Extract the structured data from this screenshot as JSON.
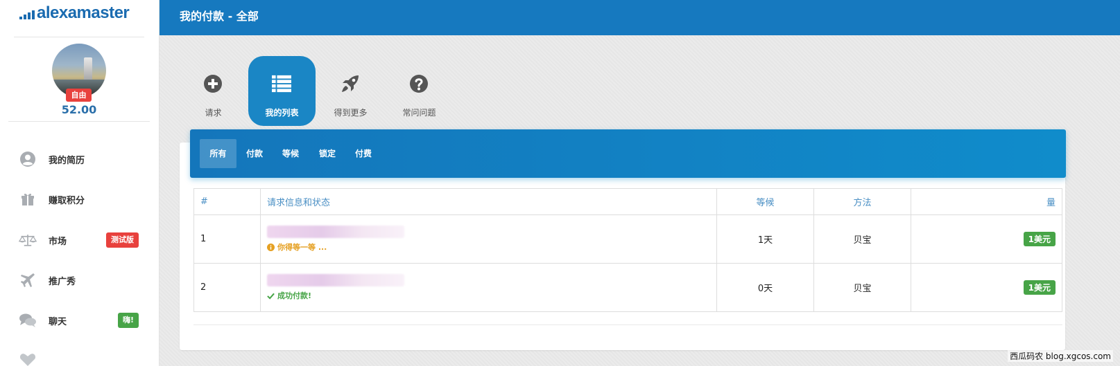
{
  "brand": {
    "name": "alexamaster",
    "color": "#1a6bb0"
  },
  "profile": {
    "badge": "自由",
    "points": "52.00"
  },
  "sidebar": {
    "items": [
      {
        "label": "我的简历",
        "icon": "user-circle-icon",
        "badge": ""
      },
      {
        "label": "赚取积分",
        "icon": "gift-icon",
        "badge": ""
      },
      {
        "label": "市场",
        "icon": "scale-icon",
        "badge": "测试版",
        "badge_color": "#e8413d"
      },
      {
        "label": "推广秀",
        "icon": "plane-icon",
        "badge": ""
      },
      {
        "label": "聊天",
        "icon": "chat-icon",
        "badge": "嗨!",
        "badge_color": "#47a447"
      }
    ]
  },
  "header": {
    "title": "我的付款 - 全部",
    "color": "#1679bf"
  },
  "actions": [
    {
      "label": "请求",
      "icon": "plus-circle-icon"
    },
    {
      "label": "我的列表",
      "icon": "list-icon",
      "active": true
    },
    {
      "label": "得到更多",
      "icon": "rocket-icon"
    },
    {
      "label": "常问问题",
      "icon": "question-circle-icon"
    }
  ],
  "tabs": [
    {
      "label": "所有",
      "active": true
    },
    {
      "label": "付款"
    },
    {
      "label": "等候"
    },
    {
      "label": "锁定"
    },
    {
      "label": "付费"
    }
  ],
  "table": {
    "columns": [
      "#",
      "请求信息和状态",
      "等候",
      "方法",
      "量"
    ],
    "rows": [
      {
        "index": "1",
        "status": "你得等一等 ...",
        "status_type": "waiting",
        "status_icon": "info-circle-icon",
        "wait": "1天",
        "method": "贝宝",
        "amount": "1美元"
      },
      {
        "index": "2",
        "status": "成功付款!",
        "status_type": "success",
        "status_icon": "check-icon",
        "wait": "0天",
        "method": "贝宝",
        "amount": "1美元"
      }
    ]
  },
  "watermark": "西瓜码农 blog.xgcos.com"
}
